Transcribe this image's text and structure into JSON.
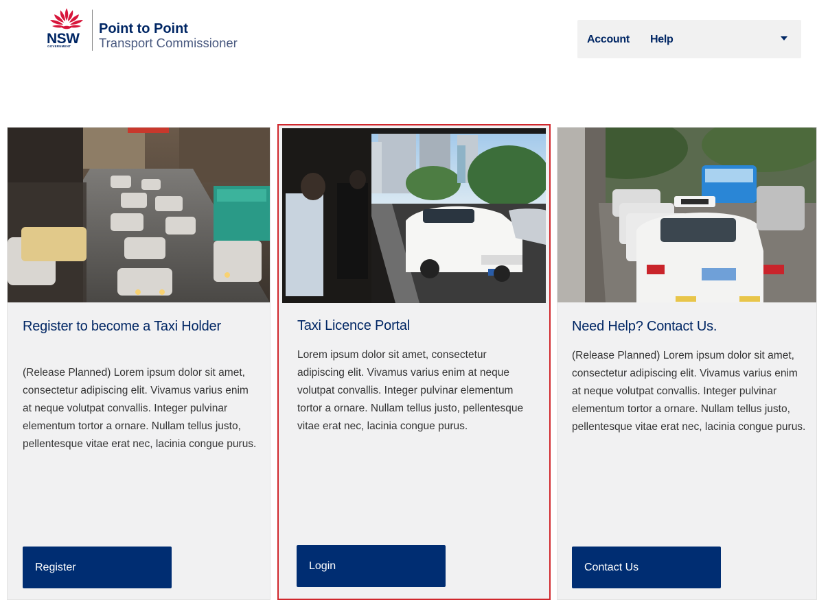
{
  "header": {
    "logo": {
      "org": "NSW",
      "gov": "GOVERNMENT",
      "title": "Point to Point",
      "subtitle": "Transport Commissioner"
    },
    "nav": {
      "account": "Account",
      "help": "Help"
    }
  },
  "cards": [
    {
      "title": "Register to become a Taxi Holder",
      "body": "(Release Planned) Lorem ipsum dolor sit amet, consectetur adipiscing elit. Vivamus varius enim at neque volutpat convallis. Integer pulvinar elementum tortor a ornare. Nullam tellus justo, pellentesque vitae erat nec, lacinia congue purus.",
      "button": "Register"
    },
    {
      "title": "Taxi Licence Portal",
      "body": "Lorem ipsum dolor sit amet, consectetur adipiscing elit. Vivamus varius enim at neque volutpat convallis. Integer pulvinar elementum tortor a ornare. Nullam tellus justo, pellentesque vitae erat nec, lacinia congue purus.",
      "button": "Login"
    },
    {
      "title": "Need Help? Contact Us.",
      "body": "(Release Planned) Lorem ipsum dolor sit amet, consectetur adipiscing elit. Vivamus varius enim at neque volutpat convallis. Integer pulvinar elementum tortor a ornare. Nullam tellus justo, pellentesque vitae erat nec, lacinia congue purus.",
      "button": "Contact Us"
    }
  ],
  "colors": {
    "brand_navy": "#002664",
    "button_navy": "#002d72",
    "waratah_red": "#d7153a",
    "selected_border": "#d0272c",
    "card_bg": "#f1f1f2"
  }
}
